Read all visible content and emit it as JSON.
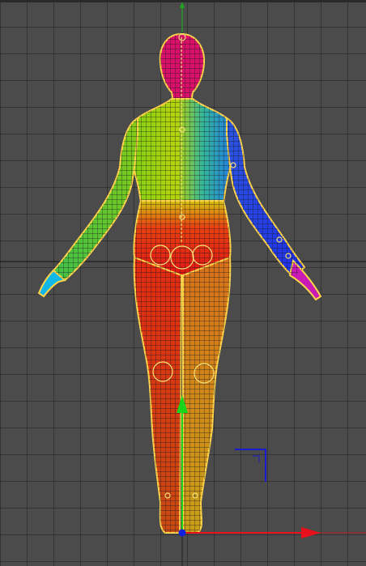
{
  "viewport": {
    "view": "front",
    "background_color": "#4b4b4b",
    "grid_color": "#2c2c2c"
  },
  "model": {
    "type": "humanoid-mesh-wireframe",
    "pose": "a-pose",
    "selected": true,
    "selection_outline_color": "#ffd000",
    "segment_colors": {
      "head": "#d8106a",
      "torso_left": "#8ed10e",
      "torso_right": "#2a9fd8",
      "upper_arm_left": "#58c81a",
      "upper_arm_right": "#1f42e8",
      "hand_left": "#11b7e6",
      "hand_right": "#c81bb6",
      "abdomen": "#e31818",
      "leg_left": "#d83a10",
      "leg_right": "#c89010"
    }
  },
  "gizmo": {
    "x_axis_color": "#e8101a",
    "y_axis_color": "#19d61b",
    "z_axis_color": "#1020e0"
  },
  "axes_lines": {
    "world_y_color": "#1ea51e",
    "world_x_color": "#b71a1a"
  }
}
